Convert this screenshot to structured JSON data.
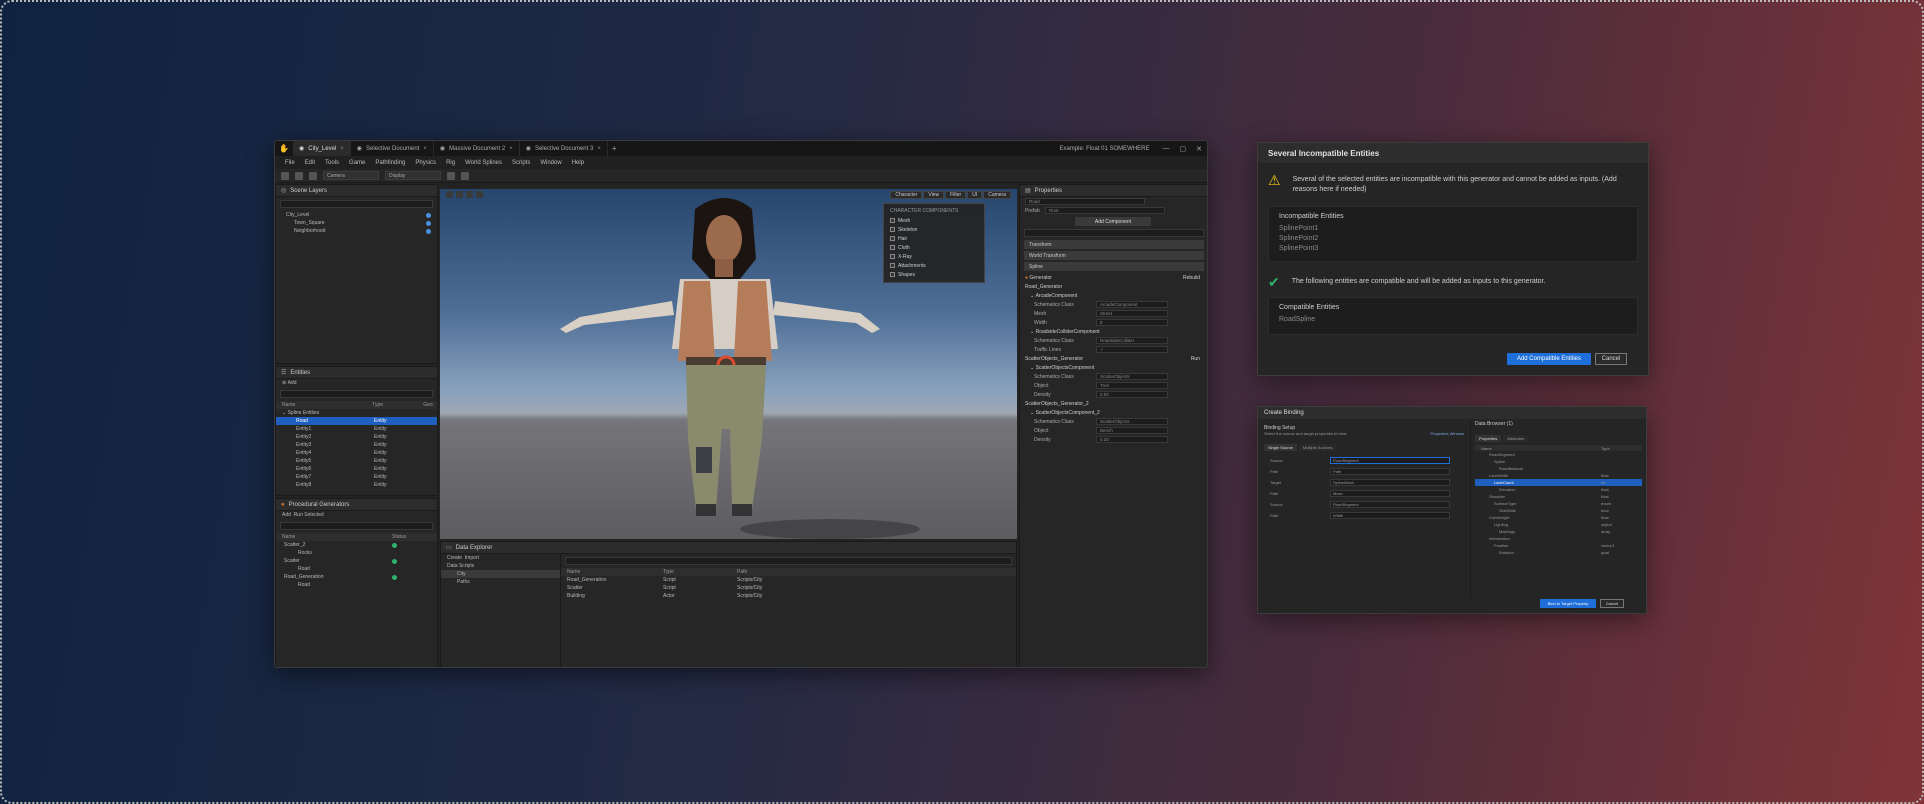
{
  "editor": {
    "tabs": [
      {
        "label": "City_Level",
        "active": true
      },
      {
        "label": "Selective Document",
        "active": false
      },
      {
        "label": "Massive Document 2",
        "active": false
      },
      {
        "label": "Selective Document 3",
        "active": false
      }
    ],
    "window_title": "Example: Float 01 SOMEWHERE",
    "menu": [
      "File",
      "Edit",
      "Tools",
      "Game",
      "Pathfinding",
      "Physics",
      "Rig",
      "World Splines",
      "Scripts",
      "Window",
      "Help"
    ],
    "toolbar": {
      "select1": "Camera",
      "select2": "Display"
    },
    "scene_layers": {
      "title": "Scene Layers",
      "items": [
        {
          "label": "City_Level",
          "dot": "#4a90e2"
        },
        {
          "label": "Town_Square",
          "dot": "#4a90e2"
        },
        {
          "label": "Neighborhood",
          "dot": "#4a90e2"
        }
      ]
    },
    "entities": {
      "title": "Entities",
      "filter": "Add",
      "columns": [
        "Name",
        "Type",
        "Geo"
      ],
      "root": "Spline Entities",
      "rows": [
        {
          "name": "Road",
          "type": "Entity",
          "selected": true
        },
        {
          "name": "Entity1",
          "type": "Entity"
        },
        {
          "name": "Entity2",
          "type": "Entity"
        },
        {
          "name": "Entity3",
          "type": "Entity"
        },
        {
          "name": "Entity4",
          "type": "Entity"
        },
        {
          "name": "Entity5",
          "type": "Entity"
        },
        {
          "name": "Entity6",
          "type": "Entity"
        },
        {
          "name": "Entity7",
          "type": "Entity"
        },
        {
          "name": "Entity8",
          "type": "Entity"
        }
      ]
    },
    "procedural": {
      "title": "Procedural Generators",
      "add": "Add",
      "run_selected": "Run Selected",
      "columns": [
        "Name",
        "Status"
      ],
      "rows": [
        {
          "name": "Scatter_2",
          "indent": 0,
          "ok": true
        },
        {
          "name": "Rocks",
          "indent": 1,
          "ok": false
        },
        {
          "name": "Scatter",
          "indent": 0,
          "ok": true
        },
        {
          "name": "Road",
          "indent": 1,
          "ok": false
        },
        {
          "name": "Road_Generation",
          "indent": 0,
          "ok": true
        },
        {
          "name": "Road",
          "indent": 1,
          "ok": false
        }
      ]
    },
    "explorer": {
      "title": "Data Explorer",
      "create": "Create",
      "import": "Import",
      "tree": [
        "Data Scripts",
        "City",
        "Paths"
      ],
      "columns": [
        "Name",
        "Type",
        "Path"
      ],
      "rows": [
        {
          "name": "Road_Generation",
          "type": "Script",
          "path": "Scripts/City"
        },
        {
          "name": "Scatter",
          "type": "Script",
          "path": "Scripts/City"
        },
        {
          "name": "Building",
          "type": "Actor",
          "path": "Scripts/City"
        }
      ]
    },
    "viewport": {
      "tabs": [
        "Character",
        "View",
        "Filter",
        "UI",
        "Camera"
      ],
      "popup_title": "CHARACTER COMPONENTS",
      "popup_items": [
        "Mesh",
        "Skeleton",
        "Hair",
        "Cloth",
        "X-Ray",
        "Attachments",
        "Shapes"
      ]
    },
    "properties": {
      "title": "Properties",
      "name_field": "Road",
      "prefab_label": "Prefab",
      "prefab_value": "Root",
      "add_component": "Add Component",
      "sections": [
        "Transform",
        "World Transform",
        "Spline"
      ],
      "generator_label": "Generator",
      "generator_action": "Rebuild",
      "road_label": "Road_Generator",
      "comp1": "ArcadeComponent",
      "comp1_rows": [
        {
          "label": "Schematics Class",
          "value": "ArcadeComponent"
        },
        {
          "label": "Mesh",
          "value": "Street"
        },
        {
          "label": "Width",
          "value": "8"
        }
      ],
      "comp2": "RoadsideColliderComponent",
      "comp2_rows": [
        {
          "label": "Schematics Class",
          "value": "RoadsideCollider"
        },
        {
          "label": "Traffic Lines",
          "value": "✓"
        }
      ],
      "scatter_label": "ScatterObjects_Generator",
      "scatter_action": "Run",
      "comp3": "ScatterObjectsComponent",
      "comp3_rows": [
        {
          "label": "Schematics Class",
          "value": "ScatterObjects"
        },
        {
          "label": "Object",
          "value": "Tree"
        },
        {
          "label": "Density",
          "value": "0.50"
        }
      ],
      "scatter2_label": "ScatterObjects_Generator_2",
      "comp4": "ScatterObjectsComponent_2",
      "comp4_rows": [
        {
          "label": "Schematics Class",
          "value": "ScatterObjects"
        },
        {
          "label": "Object",
          "value": "Bench"
        },
        {
          "label": "Density",
          "value": "0.20"
        }
      ]
    }
  },
  "dialog_incompatible": {
    "title": "Several Incompatible Entities",
    "warning": "Several of the selected entities are incompatible with this generator and cannot be added as inputs. (Add reasons here if needed)",
    "incompatible_title": "Incompatible Entities",
    "incompatible_items": [
      "SplinePoint1",
      "SplinePoint2",
      "SplinePoint3"
    ],
    "ok_message": "The following entities are compatible and will be added as inputs to this generator.",
    "compatible_title": "Compatible Entities",
    "compatible_items": [
      "RoadSpline"
    ],
    "primary_button": "Add Compatible Entities",
    "cancel_button": "Cancel"
  },
  "dialog_binding": {
    "title": "Create Binding",
    "left_title": "Binding Setup",
    "left_sub": "Select the source and target properties to bind.",
    "left_link": "Properties Window",
    "tab1": "Single Source",
    "tab2": "Multiple Sources",
    "rows": [
      {
        "label": "Source",
        "value": "RoadSegment"
      },
      {
        "label": "Path",
        "value": "Path"
      },
      {
        "label": "Target",
        "value": "SplineMesh"
      },
      {
        "label": "Path",
        "value": "Mesh"
      },
      {
        "label": "Source",
        "value": "RoadSegment"
      },
      {
        "label": "Path",
        "value": "Width"
      }
    ],
    "right_title": "Data Browser (1)",
    "right_tab1": "Properties",
    "right_tab2": "Attributes",
    "right_columns": [
      "Name",
      "Type"
    ],
    "right_rows": [
      {
        "name": "RoadSegment",
        "type": ""
      },
      {
        "name": "Spline",
        "type": ""
      },
      {
        "name": "RoadNetwork",
        "type": ""
      },
      {
        "name": "LaneWidth",
        "type": "float"
      },
      {
        "name": "LaneCount",
        "type": "int",
        "selected": true
      },
      {
        "name": "Elevation",
        "type": "float"
      },
      {
        "name": "Shoulder",
        "type": "float"
      },
      {
        "name": "SurfaceType",
        "type": "enum"
      },
      {
        "name": "SideWalk",
        "type": "bool"
      },
      {
        "name": "CurbHeight",
        "type": "float"
      },
      {
        "name": "Lighting",
        "type": "object"
      },
      {
        "name": "Markings",
        "type": "array"
      },
      {
        "name": "Intersection",
        "type": ""
      },
      {
        "name": "Position",
        "type": "vector3"
      },
      {
        "name": "Rotation",
        "type": "quat"
      }
    ],
    "primary_button": "Bind to Target Property",
    "cancel_button": "Cancel"
  }
}
